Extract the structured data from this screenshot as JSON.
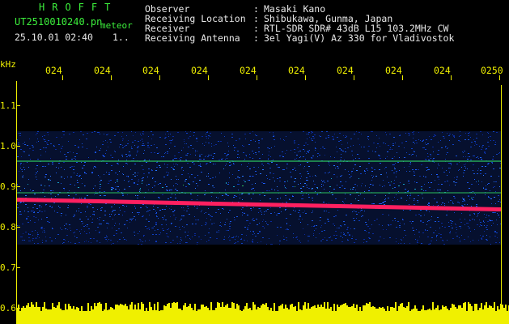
{
  "header": {
    "brand": "HROFFT",
    "filename": "UT2510010240.pn",
    "mode": "meteor",
    "datetime": "25.10.01 02:40",
    "count": "1.."
  },
  "meta": [
    {
      "label": "Observer",
      "sep": ":",
      "value": "Masaki Kano"
    },
    {
      "label": "Receiving Location",
      "sep": ":",
      "value": "Shibukawa, Gunma, Japan"
    },
    {
      "label": "Receiver",
      "sep": ":",
      "value": "RTL-SDR SDR# 43dB L15 103.2MHz CW"
    },
    {
      "label": "Receiving Antenna",
      "sep": ":",
      "value": "3el Yagi(V) Az 330 for Vladivostok"
    }
  ],
  "axes": {
    "y_unit": "kHz",
    "y_ticks": [
      "1.1",
      "1.0",
      "0.9",
      "0.8",
      "0.7",
      "0.6"
    ],
    "x_ticks": [
      "024",
      "024",
      "024",
      "024",
      "024",
      "024",
      "024",
      "024",
      "024",
      "0250"
    ]
  },
  "colors": {
    "text_green": "#3cf03c",
    "text_yellow": "#f0f000",
    "background": "#000000",
    "noise_blue": "#1040c0",
    "signal_red": "#ff2060"
  }
}
